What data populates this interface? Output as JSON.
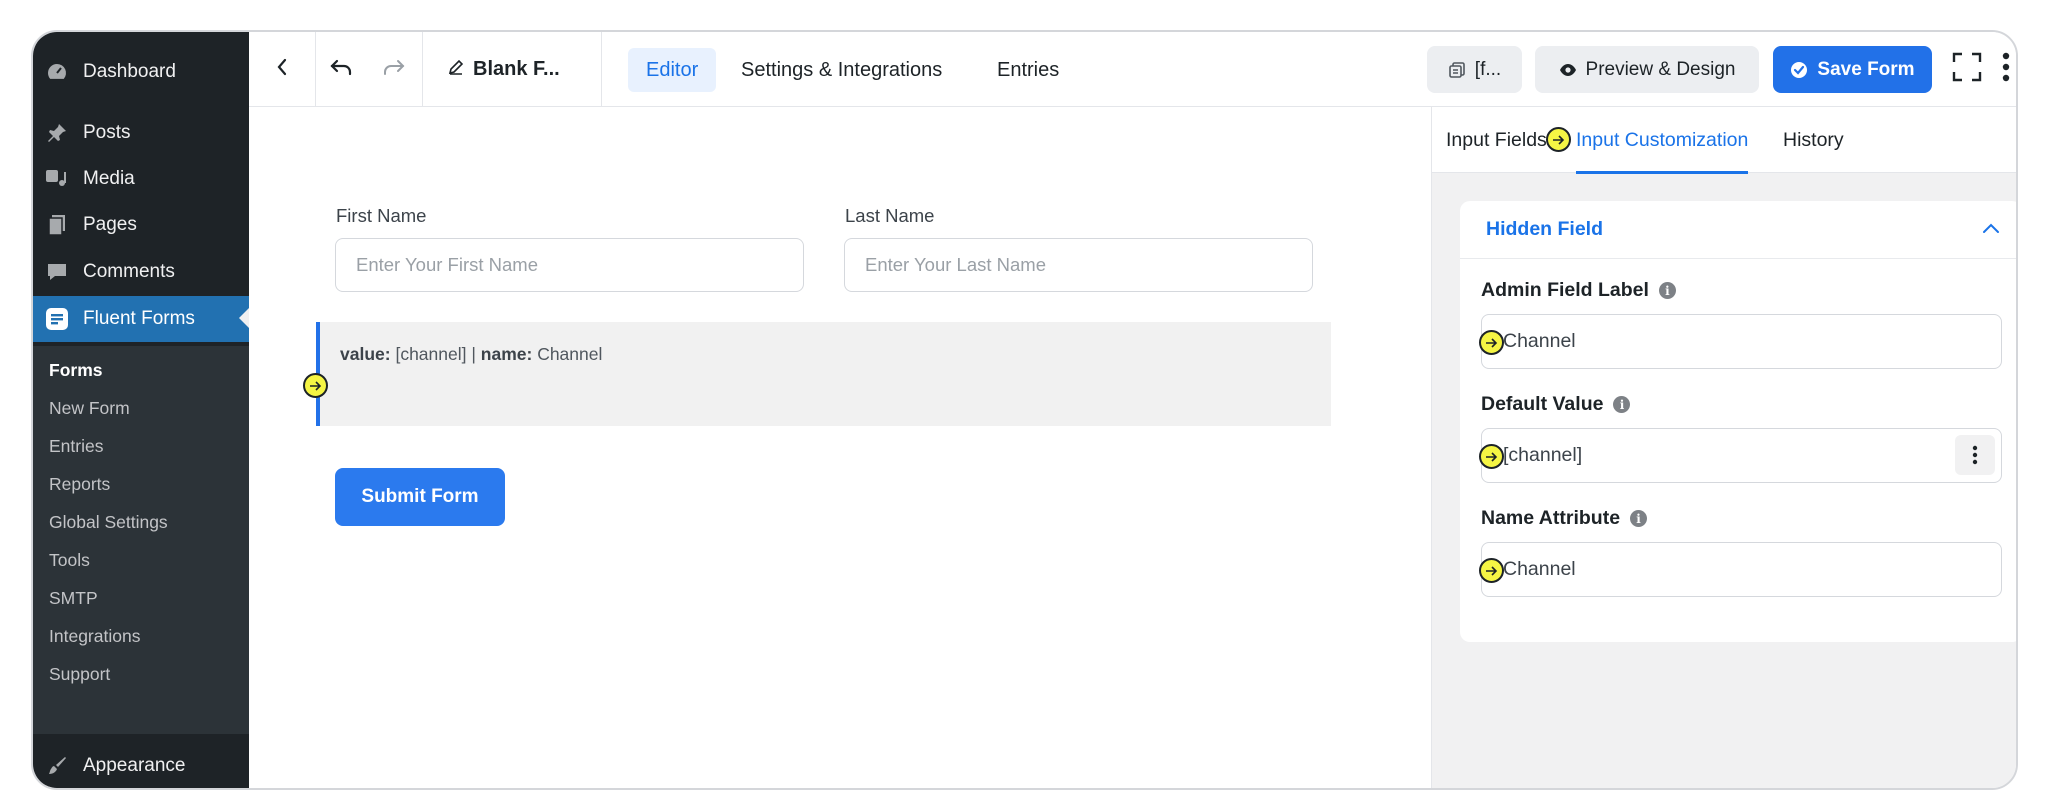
{
  "sidebar": {
    "items": [
      {
        "label": "Dashboard",
        "icon": "gauge-icon"
      },
      {
        "label": "Posts",
        "icon": "pin-icon"
      },
      {
        "label": "Media",
        "icon": "media-icon"
      },
      {
        "label": "Pages",
        "icon": "pages-icon"
      },
      {
        "label": "Comments",
        "icon": "comment-icon"
      },
      {
        "label": "Fluent Forms",
        "icon": "fluent-forms-icon"
      }
    ],
    "submenu": [
      "Forms",
      "New Form",
      "Entries",
      "Reports",
      "Global Settings",
      "Tools",
      "SMTP",
      "Integrations",
      "Support"
    ],
    "appearance": {
      "label": "Appearance",
      "icon": "brush-icon"
    }
  },
  "toolbar": {
    "form_title": "Blank F...",
    "tabs": [
      "Editor",
      "Settings & Integrations",
      "Entries"
    ],
    "shortcode_label": "[f...",
    "preview_label": "Preview & Design",
    "save_label": "Save Form"
  },
  "form": {
    "first_name_label": "First Name",
    "first_name_placeholder": "Enter Your First Name",
    "last_name_label": "Last Name",
    "last_name_placeholder": "Enter Your Last Name",
    "hidden_value_key": "value:",
    "hidden_value": "[channel] |",
    "hidden_name_key": "name:",
    "hidden_name": "Channel",
    "submit_label": "Submit Form"
  },
  "panel": {
    "tabs": [
      "Input Fields",
      "Input Customization",
      "History"
    ],
    "section_title": "Hidden Field",
    "admin_label_title": "Admin Field Label",
    "admin_label_value": "Channel",
    "default_value_title": "Default Value",
    "default_value": "[channel]",
    "name_attr_title": "Name Attribute",
    "name_attr_value": "Channel"
  },
  "colors": {
    "accent": "#1a73e8",
    "wp_active": "#2271b1",
    "marker": "#f5f544"
  }
}
